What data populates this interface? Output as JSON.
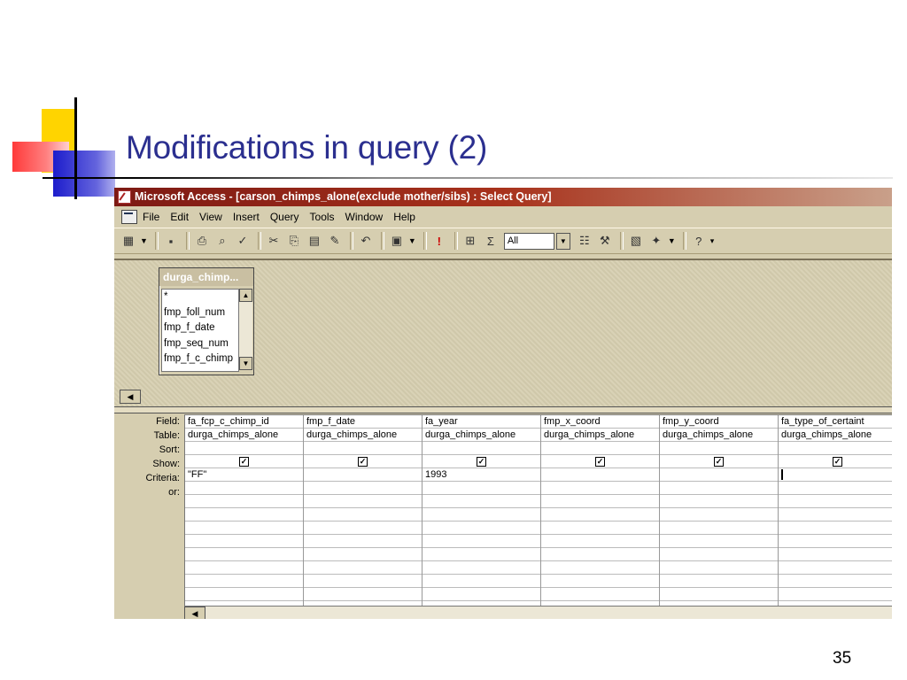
{
  "slide": {
    "title": "Modifications in query (2)",
    "page_number": "35"
  },
  "window": {
    "title": "Microsoft Access - [carson_chimps_alone(exclude mother/sibs) : Select Query]"
  },
  "menu": [
    "File",
    "Edit",
    "View",
    "Insert",
    "Query",
    "Tools",
    "Window",
    "Help"
  ],
  "toolbar": {
    "top_values": "All"
  },
  "field_list": {
    "title": "durga_chimp...",
    "items": [
      "*",
      "fmp_foll_num",
      "fmp_f_date",
      "fmp_seq_num",
      "fmp_f_c_chimp"
    ]
  },
  "grid": {
    "row_labels": [
      "Field:",
      "Table:",
      "Sort:",
      "Show:",
      "Criteria:",
      "or:"
    ],
    "columns": [
      {
        "field": "fa_fcp_c_chimp_id",
        "table": "durga_chimps_alone",
        "sort": "",
        "show": true,
        "criteria": "\"FF\"",
        "or": ""
      },
      {
        "field": "fmp_f_date",
        "table": "durga_chimps_alone",
        "sort": "",
        "show": true,
        "criteria": "",
        "or": ""
      },
      {
        "field": "fa_year",
        "table": "durga_chimps_alone",
        "sort": "",
        "show": true,
        "criteria": "1993",
        "or": ""
      },
      {
        "field": "fmp_x_coord",
        "table": "durga_chimps_alone",
        "sort": "",
        "show": true,
        "criteria": "",
        "or": ""
      },
      {
        "field": "fmp_y_coord",
        "table": "durga_chimps_alone",
        "sort": "",
        "show": true,
        "criteria": "",
        "or": ""
      },
      {
        "field": "fa_type_of_certaint",
        "table": "durga_chimps_alone",
        "sort": "",
        "show": true,
        "criteria": "",
        "or": ""
      }
    ]
  }
}
